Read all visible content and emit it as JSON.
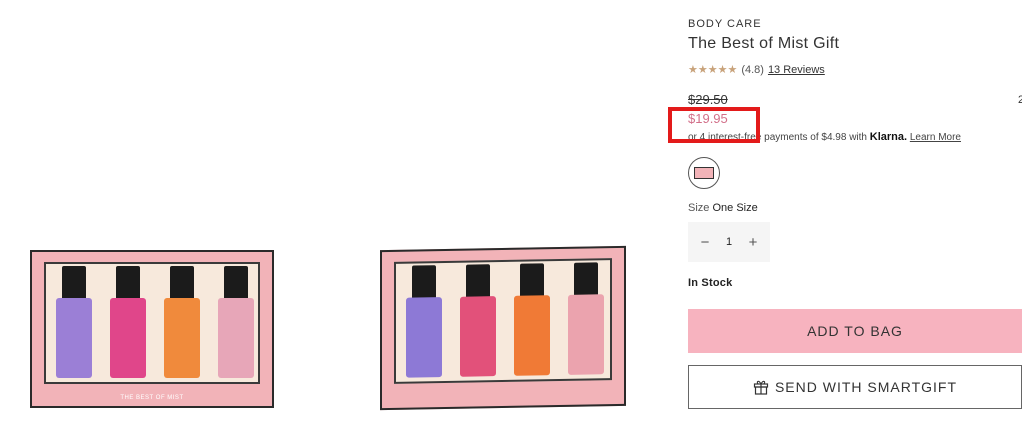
{
  "product": {
    "category": "BODY CARE",
    "title": "The Best of Mist Gift",
    "rating_stars": "★★★★★",
    "rating": "(4.8)",
    "reviews_link": "13 Reviews",
    "original_price": "$29.50",
    "sale_price": "$19.95",
    "klarna_text": "or 4 interest-free payments of $4.98 with",
    "klarna_brand": "Klarna.",
    "klarna_learn_more": "Learn More",
    "edge_glyph": "2",
    "size_label": "Size",
    "size_value": "One Size",
    "quantity": "1",
    "qty_minus": "−",
    "qty_plus": "+",
    "stock_status": "In Stock",
    "add_to_bag": "ADD TO BAG",
    "smartgift": "SEND WITH SMARTGIFT",
    "box_caption": "THE BEST OF MIST"
  },
  "colors": {
    "sale_price": "#d26f89",
    "add_to_bag_bg": "#f7b3bf",
    "stars": "#c8a27a",
    "highlight": "#e31a1a",
    "box_pink": "#f2b3b8"
  },
  "icons": {
    "gift": "gift-icon",
    "minus": "minus-icon",
    "plus": "plus-icon"
  }
}
